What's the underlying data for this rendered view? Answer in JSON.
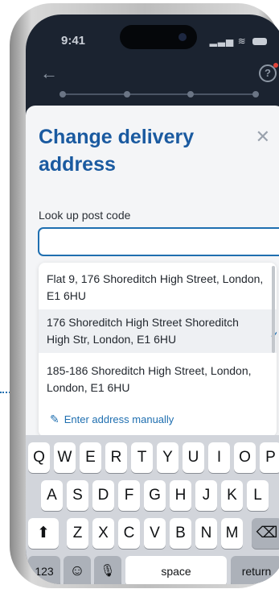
{
  "status_bar": {
    "time": "9:41",
    "signal_icon": "signal-icon",
    "wifi_icon": "wifi-icon",
    "battery_icon": "battery-icon"
  },
  "nav": {
    "back_icon": "arrow-left-icon",
    "help_icon": "help-icon",
    "help_glyph": "?"
  },
  "sheet": {
    "title": "Change delivery address",
    "close_glyph": "✕",
    "lookup_label": "Look up post code",
    "lookup_value": "",
    "options": [
      {
        "text": "Flat 9, 176 Shoreditch High Street, London, E1 6HU",
        "selected": false
      },
      {
        "text": "176 Shoreditch High Street Shoreditch High Str, London, E1 6HU",
        "selected": true
      },
      {
        "text": "185-186 Shoreditch High Street, London, London, E1 6HU",
        "selected": false
      }
    ],
    "check_glyph": "✓",
    "manual_link": "Enter address manually",
    "pencil_glyph": "✎"
  },
  "keyboard": {
    "row1": [
      "Q",
      "W",
      "E",
      "R",
      "T",
      "Y",
      "U",
      "I",
      "O",
      "P"
    ],
    "row2": [
      "A",
      "S",
      "D",
      "F",
      "G",
      "H",
      "J",
      "K",
      "L"
    ],
    "row3": [
      "Z",
      "X",
      "C",
      "V",
      "B",
      "N",
      "M"
    ],
    "shift": "⬆",
    "delete": "⌫",
    "numbers": "123",
    "emoji": "☺",
    "mic": "🎙",
    "space": "space",
    "return": "return"
  },
  "colors": {
    "accent": "#1f6fb0",
    "title": "#1a5aa0"
  }
}
